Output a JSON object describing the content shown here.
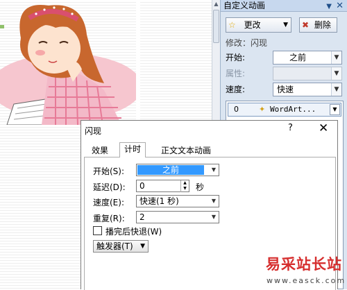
{
  "task_pane": {
    "title": "自定义动画",
    "change_button": "更改",
    "delete_button": "删除",
    "modify_label": "修改：闪现",
    "start_label": "开始:",
    "start_value": "之前",
    "property_label": "属性:",
    "speed_label": "速度:",
    "speed_value": "快速",
    "list_item_index": "0",
    "list_item_text": "WordArt..."
  },
  "dialog": {
    "title": "闪现",
    "help_glyph": "?",
    "close_glyph": "✕",
    "tabs": [
      "效果",
      "计时",
      "正文文本动画"
    ],
    "active_tab": 1,
    "start_label": "开始(S):",
    "start_value": "之前",
    "delay_label": "延迟(D):",
    "delay_value": "0",
    "delay_unit": "秒",
    "speed_label": "速度(E):",
    "speed_value": "快速(1 秒)",
    "repeat_label": "重复(R):",
    "repeat_value": "2",
    "rewind_label": "播完后快退(W)",
    "rewind_checked": false,
    "trigger_label": "触发器(T)"
  },
  "watermark": {
    "text": "易采站长站",
    "url": "www.easck.com",
    "color": "#d62e2e"
  },
  "colors": {
    "pane_bg": "#dbe5f1",
    "selection": "#3399ff"
  }
}
